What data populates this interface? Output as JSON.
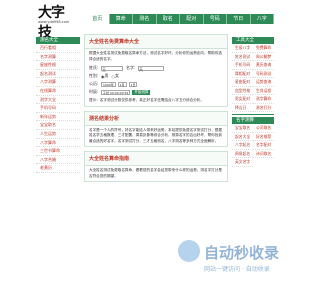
{
  "header": {
    "logo_text": "大字技",
    "logo_url": "www.ydd998.com"
  },
  "nav": [
    "首页",
    "算命",
    "测名",
    "取名",
    "配对",
    "号码",
    "节日",
    "八字"
  ],
  "left_sidebar": {
    "title": "测名大全",
    "items": [
      "百行看相",
      "名字测算",
      "星座性格",
      "起名测试",
      "八字测算",
      "在线算命",
      "测字大全",
      "手机号码",
      "新年运势",
      "宝宝取名",
      "人生运势",
      "八字算命",
      "三世书算命",
      "八字合婚",
      "老黄历"
    ]
  },
  "main": {
    "title": "大全姓名免费算命大全",
    "intro": "根据大全姓名测试免费取名算命方法，测试名字好坏，分析你的运势走向，帮助你选择合适的名字。",
    "form": {
      "surname_label": "姓氏:",
      "surname_value": "王",
      "name_label": "名字:",
      "name_value": "天",
      "gender_label": "性别:",
      "gender_options": [
        "男",
        "女"
      ],
      "birth_label": "公历:",
      "year": "1990年",
      "month": "1月",
      "day": "1日",
      "hour_label": "时辰:",
      "hour": "子时 00:00-00:59",
      "submit_label": "开始测算"
    },
    "note": "提示：名字测试分数仅供参考，真正好名字还需结合八字五行综合分析。",
    "section2_title": "测名结果分析",
    "section2_text": "名字是一个人的符号，好名字能给人带来好运势，本站提供免费名字测试打分，根据姓名学五格数理、三才配置、周易卦象等综合分析，测算名字的吉凶好坏，帮你找到最合适的好名字。名字测试打分，三才五格测名，八字测名等多种方式全面解析。",
    "section3_title": "大全姓名算命指南",
    "section3_text": "大全姓名测试免费取名算命，看看您的名字会给您带来什么样的运势，测名字打分是否符合您的期望。"
  },
  "right_sidebar": {
    "title": "工具大全",
    "items": [
      "生辰八字",
      "免费算命",
      "姓名测试",
      "周公解梦",
      "手机号码",
      "黄历查询",
      "属相配对",
      "号码测试",
      "星座配对",
      "运势查询",
      "血型性格",
      "生肖运程",
      "男女配对",
      "测字算命",
      "择吉日",
      "测名打分"
    ],
    "title2": "名字测算",
    "items2": [
      "宝宝取名",
      "公司取名",
      "起名大全",
      "好名推荐",
      "八字起名",
      "名字配对",
      "周易起名",
      "诗词取名",
      "英文名字"
    ]
  },
  "watermark": {
    "title": "自动秒收录",
    "sub": "网站一键访问 · 自动收录"
  }
}
